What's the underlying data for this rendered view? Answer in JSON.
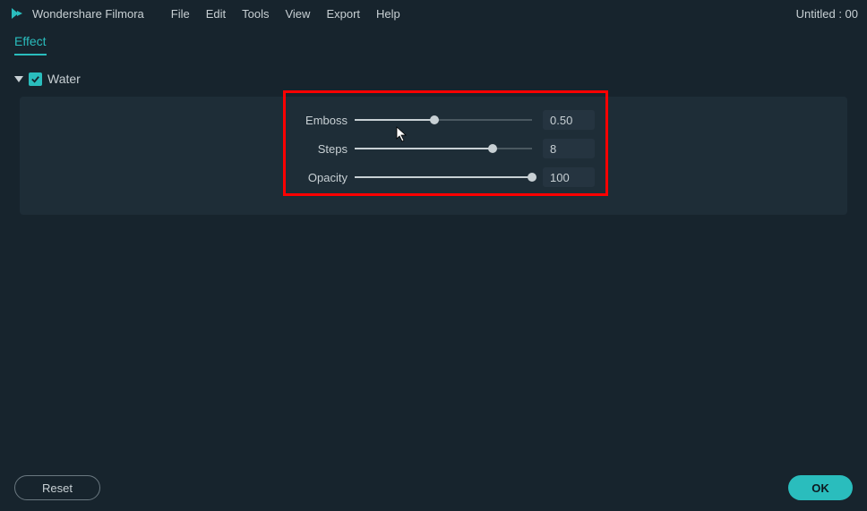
{
  "app": {
    "name": "Wondershare Filmora",
    "project": "Untitled : 00"
  },
  "menu": {
    "items": [
      "File",
      "Edit",
      "Tools",
      "View",
      "Export",
      "Help"
    ]
  },
  "tab": {
    "label": "Effect"
  },
  "effect": {
    "name": "Water",
    "checked": true
  },
  "sliders": [
    {
      "label": "Emboss",
      "value": "0.50",
      "percent": 45
    },
    {
      "label": "Steps",
      "value": "8",
      "percent": 78
    },
    {
      "label": "Opacity",
      "value": "100",
      "percent": 100
    }
  ],
  "buttons": {
    "reset": "Reset",
    "ok": "OK"
  }
}
